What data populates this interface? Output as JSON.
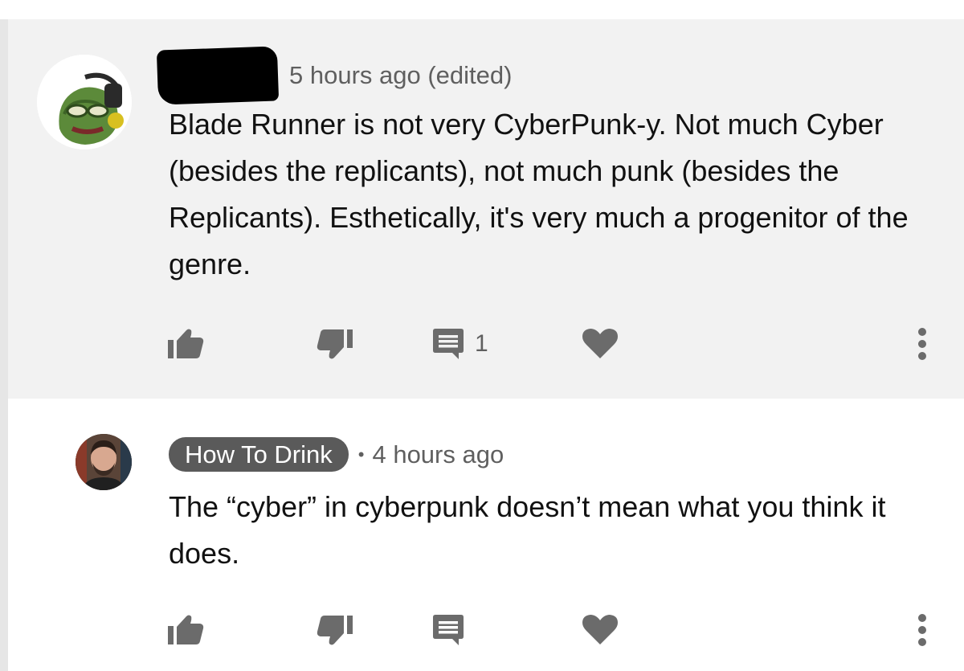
{
  "comments": [
    {
      "author": "",
      "timestamp": "5 hours ago (edited)",
      "text": "Blade Runner is not very CyberPunk-y. Not much Cyber (besides the replicants), not much punk (besides the Replicants). Esthetically, it's very much a progenitor of the genre.",
      "reply_count": "1",
      "highlighted": true
    },
    {
      "author": "How To Drink",
      "separator": "•",
      "timestamp": "4 hours ago",
      "text": "The “cyber” in cyberpunk doesn’t mean what you think it does.",
      "reply_count": "",
      "highlighted": false
    }
  ],
  "icons": {
    "like": "thumb-up-icon",
    "dislike": "thumb-down-icon",
    "reply": "comment-icon",
    "heart": "heart-icon",
    "more": "more-vert-icon"
  },
  "colors": {
    "highlight_bg": "#f2f2f2",
    "icon": "#6b6b6b",
    "author_chip": "#5a5a5a"
  }
}
